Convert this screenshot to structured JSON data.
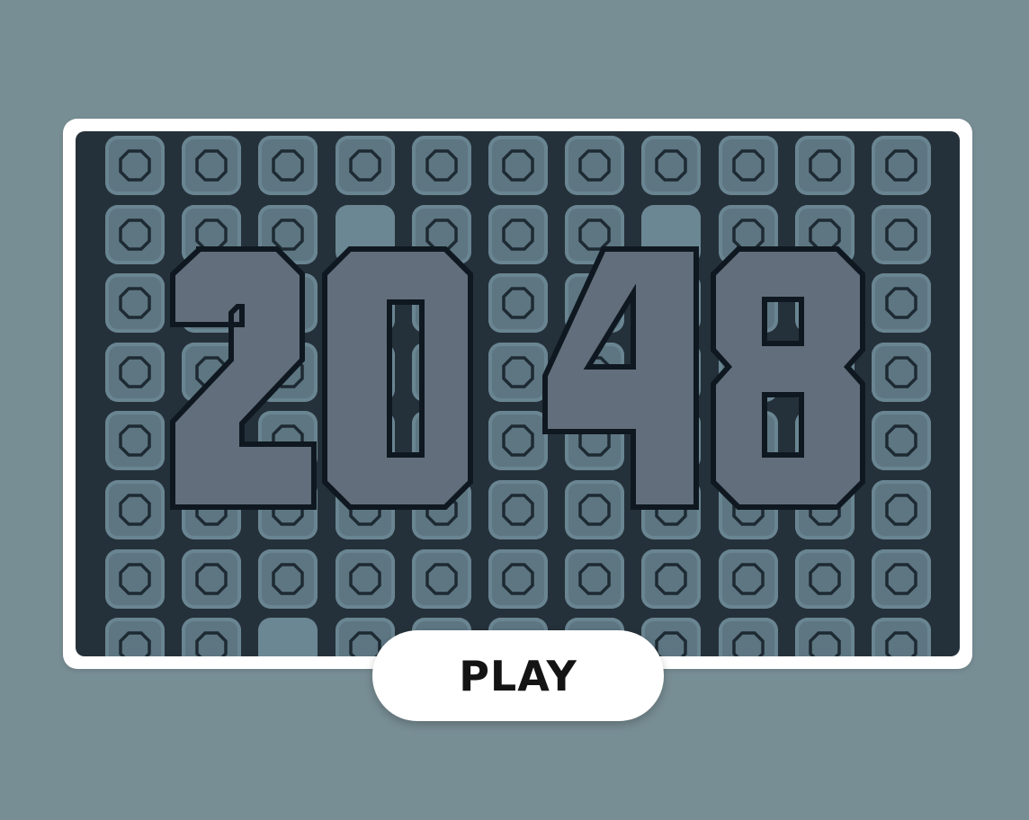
{
  "game": {
    "title": "2048",
    "play_label": "PLAY"
  },
  "board": {
    "rows": 8,
    "cols": 11,
    "empty_cells": [
      [
        1,
        3
      ],
      [
        1,
        7
      ],
      [
        7,
        2
      ]
    ]
  },
  "colors": {
    "background": "#788e95",
    "board": "#25313a",
    "cell": "#5d7682",
    "cell_border": "#6a8592",
    "empty_cell": "#6b8793",
    "ring": "#1e2a33",
    "digit_fill": "#636e7c",
    "digit_outline": "#0f1820",
    "button": "#ffffff",
    "button_text": "#141414"
  },
  "icons": {
    "cell_marker": "octagon-ring-icon"
  }
}
